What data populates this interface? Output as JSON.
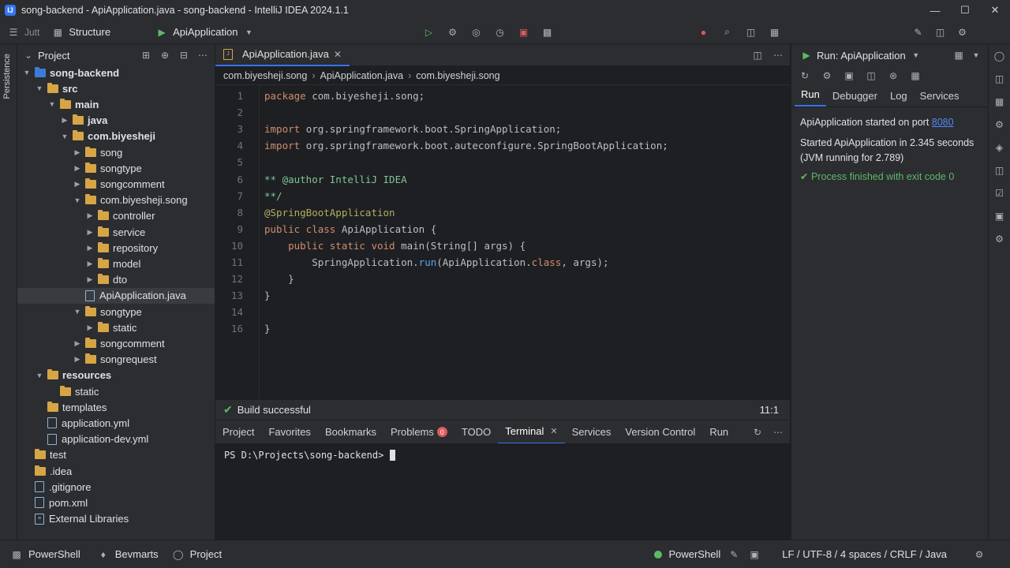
{
  "window": {
    "title": "song-backend - ApiApplication.java - song-backend - IntelliJ IDEA 2024.1.1"
  },
  "toolbar": {
    "menu_label": "Jutt",
    "structure_label": "Structure",
    "run_config": "ApiApplication"
  },
  "left_strip": {
    "label": "Persistence"
  },
  "project": {
    "header": "Project",
    "tree": [
      {
        "label": "song-backend",
        "depth": 0,
        "kind": "module",
        "arrow": "down",
        "bold": true
      },
      {
        "label": "src",
        "depth": 1,
        "kind": "folder",
        "arrow": "down",
        "bold": true
      },
      {
        "label": "main",
        "depth": 2,
        "kind": "folder",
        "arrow": "down",
        "bold": true
      },
      {
        "label": "java",
        "depth": 3,
        "kind": "folder",
        "arrow": "right",
        "bold": true
      },
      {
        "label": "com.biyesheji",
        "depth": 3,
        "kind": "folder",
        "arrow": "down",
        "bold": true
      },
      {
        "label": "song",
        "depth": 4,
        "kind": "folder",
        "arrow": "right"
      },
      {
        "label": "songtype",
        "depth": 4,
        "kind": "folder",
        "arrow": "right"
      },
      {
        "label": "songcomment",
        "depth": 4,
        "kind": "folder",
        "arrow": "right"
      },
      {
        "label": "com.biyesheji.song",
        "depth": 4,
        "kind": "folder",
        "arrow": "down"
      },
      {
        "label": "controller",
        "depth": 5,
        "kind": "folder",
        "arrow": "right"
      },
      {
        "label": "service",
        "depth": 5,
        "kind": "folder",
        "arrow": "right"
      },
      {
        "label": "repository",
        "depth": 5,
        "kind": "folder",
        "arrow": "right"
      },
      {
        "label": "model",
        "depth": 5,
        "kind": "folder",
        "arrow": "right"
      },
      {
        "label": "dto",
        "depth": 5,
        "kind": "folder",
        "arrow": "right"
      },
      {
        "label": "ApiApplication.java",
        "depth": 4,
        "kind": "file",
        "arrow": "none",
        "selected": true
      },
      {
        "label": "songtype",
        "depth": 4,
        "kind": "folder",
        "arrow": "down"
      },
      {
        "label": "static",
        "depth": 5,
        "kind": "folder",
        "arrow": "right"
      },
      {
        "label": "songcomment",
        "depth": 4,
        "kind": "folder",
        "arrow": "right"
      },
      {
        "label": "songrequest",
        "depth": 4,
        "kind": "folder",
        "arrow": "right"
      },
      {
        "label": "resources",
        "depth": 1,
        "kind": "folder",
        "arrow": "down",
        "bold": true
      },
      {
        "label": "static",
        "depth": 2,
        "kind": "folder",
        "arrow": "none"
      },
      {
        "label": "templates",
        "depth": 1,
        "kind": "folder",
        "arrow": "none"
      },
      {
        "label": "application.yml",
        "depth": 1,
        "kind": "file",
        "arrow": "none"
      },
      {
        "label": "application-dev.yml",
        "depth": 1,
        "kind": "file",
        "arrow": "none"
      },
      {
        "label": "test",
        "depth": 0,
        "kind": "folder",
        "arrow": "none"
      },
      {
        "label": ".idea",
        "depth": 0,
        "kind": "folder",
        "arrow": "none"
      },
      {
        "label": ".gitignore",
        "depth": 0,
        "kind": "file",
        "arrow": "none"
      },
      {
        "label": "pom.xml",
        "depth": 0,
        "kind": "file",
        "arrow": "none"
      },
      {
        "label": "External Libraries",
        "depth": 0,
        "kind": "lib",
        "arrow": "none"
      }
    ]
  },
  "editor": {
    "tab": "ApiApplication.java",
    "breadcrumb": [
      "com.biyesheji.song",
      "ApiApplication.java",
      "com.biyesheji.song"
    ],
    "lines": [
      [
        {
          "t": "package ",
          "c": "kw"
        },
        {
          "t": "com.biyesheji.song;",
          "c": "cl"
        }
      ],
      [],
      [
        {
          "t": "import ",
          "c": "kw"
        },
        {
          "t": "org.springframework.boot.SpringApplication;",
          "c": "cl"
        }
      ],
      [
        {
          "t": "import ",
          "c": "kw"
        },
        {
          "t": "org.springframework.boot.auteconfigure.SpringBootApplication;",
          "c": "cl"
        }
      ],
      [],
      [
        {
          "t": "** @author IntelliJ IDEA",
          "c": "cm"
        }
      ],
      [
        {
          "t": "**/",
          "c": "cm"
        }
      ],
      [
        {
          "t": "@SpringBootApplication",
          "c": "an"
        }
      ],
      [
        {
          "t": "public class ",
          "c": "kw"
        },
        {
          "t": "ApiApplication {",
          "c": "cl"
        }
      ],
      [
        {
          "t": "    public static void ",
          "c": "kw"
        },
        {
          "t": "main",
          "c": "cl"
        },
        {
          "t": "(String[] args) {",
          "c": "cl"
        }
      ],
      [
        {
          "t": "        SpringApplication.",
          "c": "cl"
        },
        {
          "t": "run",
          "c": "fn"
        },
        {
          "t": "(ApiApplication.",
          "c": "cl"
        },
        {
          "t": "class",
          "c": "kw"
        },
        {
          "t": ", args);",
          "c": "cl"
        }
      ],
      [
        {
          "t": "    }",
          "c": "cl"
        }
      ],
      [
        {
          "t": "}",
          "c": "cl"
        }
      ],
      [
        {
          "t": "}",
          "c": "cl"
        }
      ]
    ],
    "line_numbers": [
      "1",
      "2",
      "3",
      "4",
      "5",
      "6",
      "7",
      "8",
      "9",
      "10",
      "11",
      "12",
      "13",
      "14",
      "16"
    ]
  },
  "status": {
    "build": "Build successful",
    "cursor": "11:1"
  },
  "bottom_tabs": [
    {
      "label": "Project"
    },
    {
      "label": "Favorites"
    },
    {
      "label": "Bookmarks"
    },
    {
      "label": "Problems",
      "badge": "0"
    },
    {
      "label": "TODO"
    },
    {
      "label": "Terminal",
      "active": true
    },
    {
      "label": "Services"
    },
    {
      "label": "Version Control"
    },
    {
      "label": "Run"
    }
  ],
  "terminal": {
    "prompt": "PS D:\\Projects\\song-backend>"
  },
  "run": {
    "header": "Run: ApiApplication",
    "tabs": [
      "Run",
      "Debugger",
      "Log",
      "Services"
    ],
    "line1_prefix": "ApiApplication started on port ",
    "port": "8080",
    "line2": "Started ApiApplication in 2.345 seconds",
    "line3": "(JVM running for 2.789)",
    "line4": "Process finished with exit code 0"
  },
  "bottombar": {
    "left": [
      "PowerShell",
      "Bevmarts",
      "Project"
    ],
    "right_shell": "PowerShell",
    "encoding": "LF  /  UTF-8 / 4 spaces / CRLF / Java"
  },
  "colors": {
    "accent": "#3574f0",
    "success": "#5fb865",
    "badge": "#db5c5c"
  }
}
